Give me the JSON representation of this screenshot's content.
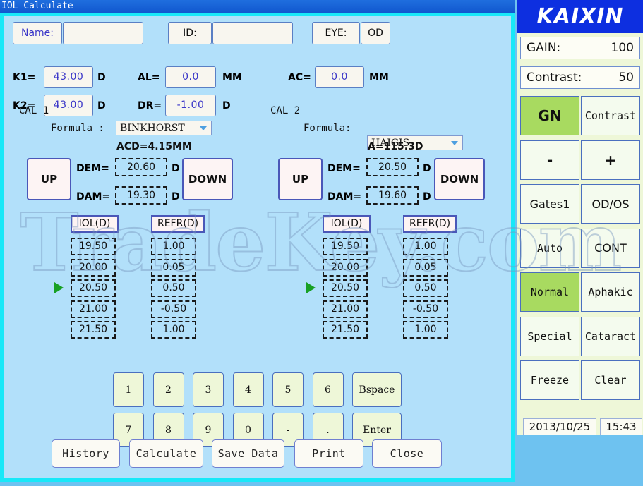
{
  "window": {
    "title": "IOL Calculate"
  },
  "watermark": {
    "text": "TradeKey.com"
  },
  "patient": {
    "name_label": "Name:",
    "name_value": "",
    "id_label": "ID:",
    "id_value": "",
    "eye_label": "EYE:",
    "eye_value": "OD"
  },
  "measurements": {
    "k1_label": "K1=",
    "k1_value": "43.00",
    "k1_unit": "D",
    "k2_label": "K2=",
    "k2_value": "43.00",
    "k2_unit": "D",
    "al_label": "AL=",
    "al_value": "0.0",
    "al_unit": "MM",
    "dr_label": "DR=",
    "dr_value": "-1.00",
    "dr_unit": "D",
    "ac_label": "AC=",
    "ac_value": "0.0",
    "ac_unit": "MM"
  },
  "cal1": {
    "title": "CAL 1",
    "formula_label": "Formula :",
    "formula_value": "BINKHORST",
    "constant": "ACD=4.15MM",
    "up_label": "UP",
    "down_label": "DOWN",
    "dem_label": "DEM=",
    "dem_value": "20.60",
    "dem_unit": "D",
    "dam_label": "DAM=",
    "dam_value": "19.30",
    "dam_unit": "D",
    "col_iol": "IOL(D)",
    "col_refr": "REFR(D)",
    "rows": [
      {
        "iol": "19.50",
        "refr": "1.00",
        "selected": false
      },
      {
        "iol": "20.00",
        "refr": "0.05",
        "selected": false
      },
      {
        "iol": "20.50",
        "refr": "0.50",
        "selected": true
      },
      {
        "iol": "21.00",
        "refr": "-0.50",
        "selected": false
      },
      {
        "iol": "21.50",
        "refr": "1.00",
        "selected": false
      }
    ]
  },
  "cal2": {
    "title": "CAL 2",
    "formula_label": "Formula:",
    "formula_value": "HAIGIS",
    "constant": "A=115.3D",
    "up_label": "UP",
    "down_label": "DOWN",
    "dem_label": "DEM=",
    "dem_value": "20.50",
    "dem_unit": "D",
    "dam_label": "DAM=",
    "dam_value": "19.60",
    "dam_unit": "D",
    "col_iol": "IOL(D)",
    "col_refr": "REFR(D)",
    "rows": [
      {
        "iol": "19.50",
        "refr": "1.00",
        "selected": false
      },
      {
        "iol": "20.00",
        "refr": "0.05",
        "selected": false
      },
      {
        "iol": "20.50",
        "refr": "0.50",
        "selected": true
      },
      {
        "iol": "21.00",
        "refr": "-0.50",
        "selected": false
      },
      {
        "iol": "21.50",
        "refr": "1.00",
        "selected": false
      }
    ]
  },
  "keypad": {
    "row1": [
      "1",
      "2",
      "3",
      "4",
      "5",
      "6"
    ],
    "row2": [
      "7",
      "8",
      "9",
      "0",
      "-",
      "."
    ],
    "bspace_label": "Bspace",
    "enter_label": "Enter"
  },
  "actions": [
    "History",
    "Calculate",
    "Save Data",
    "Print",
    "Close"
  ],
  "sidebar": {
    "brand": "KAIXIN",
    "gain_label": "GAIN:",
    "gain_value": "100",
    "contrast_label": "Contrast:",
    "contrast_value": "50",
    "buttons": [
      {
        "label": "GN",
        "active": true
      },
      {
        "label": "Contrast",
        "active": false
      },
      {
        "label": "-",
        "active": false
      },
      {
        "label": "+",
        "active": false
      },
      {
        "label": "Gates1",
        "active": false
      },
      {
        "label": "OD/OS",
        "active": false
      },
      {
        "label": "Auto",
        "active": false
      },
      {
        "label": "CONT",
        "active": false
      },
      {
        "label": "Normal",
        "active": true
      },
      {
        "label": "Aphakic",
        "active": false
      },
      {
        "label": "Special",
        "active": false
      },
      {
        "label": "Cataract",
        "active": false
      },
      {
        "label": "Freeze",
        "active": false
      },
      {
        "label": "Clear",
        "active": false
      }
    ],
    "date": "2013/10/25",
    "time": "15:43"
  },
  "colors": {
    "titlebar": "#1158cf",
    "frame": "#18e8f8",
    "client_bg": "#b2e0fa",
    "brand_bg": "#0d2fe0",
    "accent_green": "#a8da60",
    "marker_green": "#18a024"
  }
}
